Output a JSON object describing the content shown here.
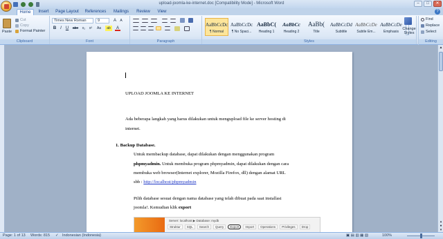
{
  "window": {
    "title": "upload-joomla-ke-internet.doc [Compatibility Mode] - Microsoft Word",
    "controls": [
      "–",
      "□",
      "✕"
    ]
  },
  "qat_icons": [
    "save-icon",
    "undo-icon",
    "redo-icon",
    "customize-icon"
  ],
  "tabs": [
    "Home",
    "Insert",
    "Page Layout",
    "References",
    "Mailings",
    "Review",
    "View"
  ],
  "ribbon": {
    "clipboard": {
      "paste": "Paste",
      "cut": "Cut",
      "copy": "Copy",
      "format_painter": "Format Painter",
      "label": "Clipboard"
    },
    "font": {
      "name": "Times New Roman",
      "size": "9",
      "bold": "B",
      "italic": "I",
      "underline": "U",
      "strike": "abe",
      "sub": "x₂",
      "sup": "x²",
      "case": "Aa",
      "highlight": "ab",
      "color": "A",
      "label": "Font"
    },
    "paragraph": {
      "label": "Paragraph"
    },
    "styles": {
      "items": [
        {
          "preview": "AaBbCcDc",
          "name": "¶ Normal"
        },
        {
          "preview": "AaBbCcDc",
          "name": "¶ No Spaci..."
        },
        {
          "preview": "AaBbC(",
          "name": "Heading 1"
        },
        {
          "preview": "AaBbCc",
          "name": "Heading 2"
        },
        {
          "preview": "AaBb(",
          "name": "Title"
        },
        {
          "preview": "AaBbCcDd",
          "name": "Subtitle"
        },
        {
          "preview": "AaBbCcDe",
          "name": "Subtle Em..."
        },
        {
          "preview": "AaBbCcDe",
          "name": "Emphasis"
        }
      ],
      "change_styles": "Change Styles",
      "label": "Styles"
    },
    "editing": {
      "find": "Find",
      "replace": "Replace",
      "select": "Select",
      "label": "Editing"
    }
  },
  "document": {
    "heading": "UPLOAD JOOMLA KE INTERNET",
    "intro_line1": "Ada beberapa langkah yang harus dilakukan   untuk mengupload file ke server hosting di",
    "intro_line2": "internet.",
    "step1_title": "1. Backup Database.",
    "step1_line1": "Untuk membackup database, dapat dilakukan dengan menggunakan program",
    "step1_bold": "phpmyadmin.",
    "step1_line2": " Untuk membuka program phpmyadmin, dapat dilakukan dengan cara",
    "step1_line3": "membuka web browser(Internet explorer, Mozilla Firefox, dll) dengan alamat URL",
    "step1_line4_prefix": "sbb :    ",
    "step1_url": "http://localhost/phpmyadmin",
    "step1_line5": "Pilih database sesuai  dengan nama database yang telah dibuat pada saat installasi",
    "step1_line6": "joomla!.  Kemudian klik ",
    "step1_export": "export",
    "screenshot": {
      "breadcrumb": "Server: localhost  ▶  Database: mydb",
      "tabs": [
        "Struktur",
        "SQL",
        "Search",
        "Query",
        "Export",
        "Import",
        "Operations",
        "Privileges",
        "Drop"
      ]
    }
  },
  "status": {
    "page": "Page: 1 of 13",
    "words": "Words: 815",
    "language": "Indonesian (Indonesia)",
    "zoom": "100%",
    "zoom_level": 0.5
  }
}
